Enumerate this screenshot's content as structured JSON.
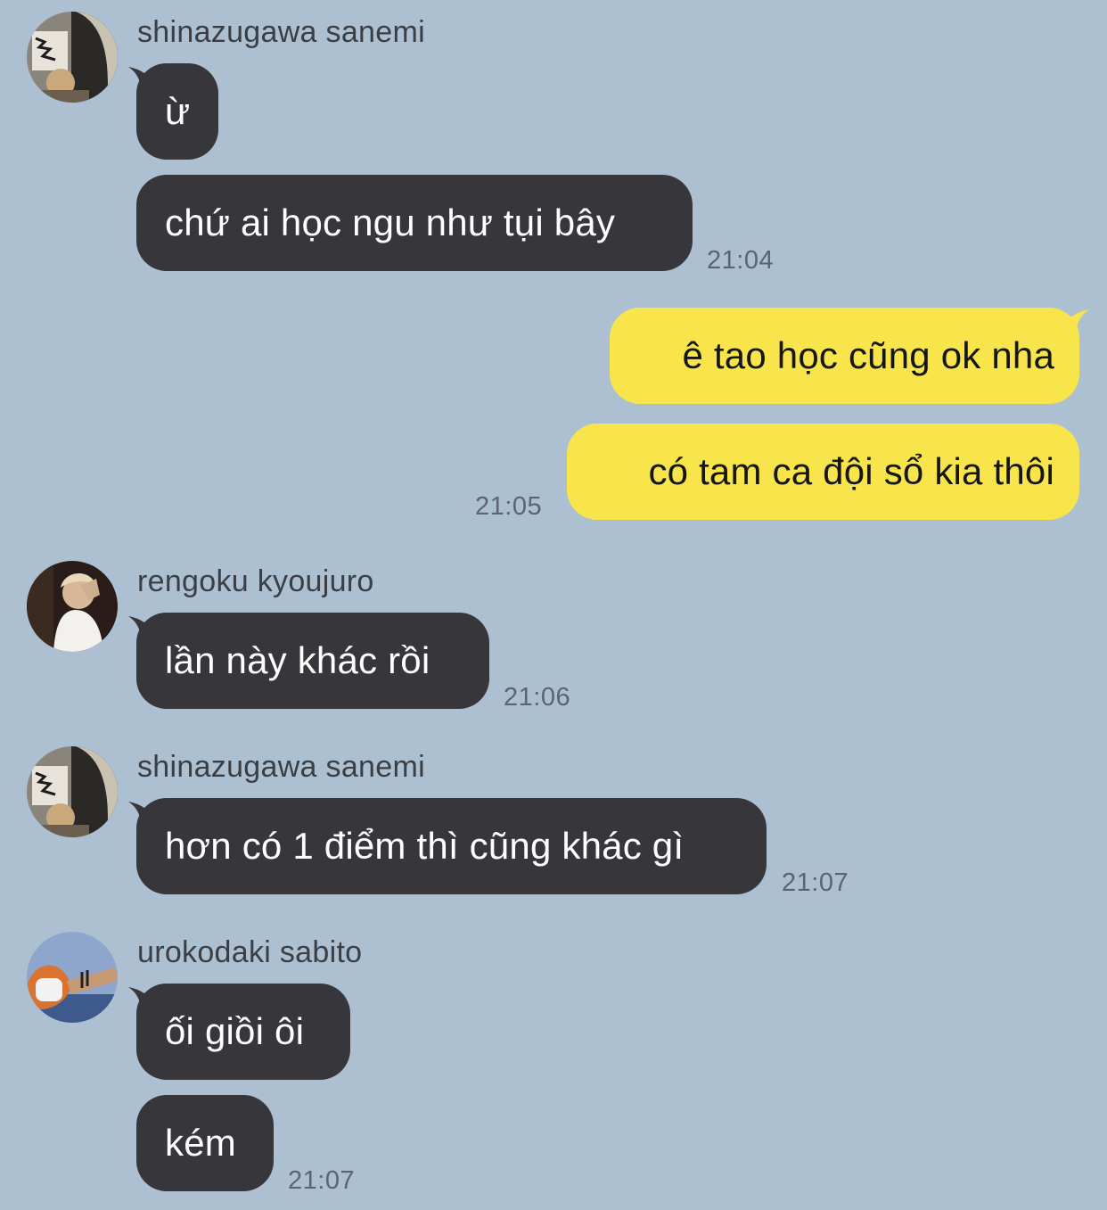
{
  "colors": {
    "background": "#adc0d1",
    "incoming_bubble": "#37373b",
    "outgoing_bubble": "#f8e54b"
  },
  "messages": [
    {
      "sender": "shinazugawa sanemi",
      "lines": [
        "ừ",
        "chứ ai học ngu như tụi bây"
      ],
      "time": "21:04"
    },
    {
      "sender": "me",
      "lines": [
        "ê tao học cũng ok nha",
        "có tam ca đội sổ kia thôi"
      ],
      "time": "21:05"
    },
    {
      "sender": "rengoku kyoujuro",
      "lines": [
        "lần này khác rồi"
      ],
      "time": "21:06"
    },
    {
      "sender": "shinazugawa sanemi",
      "lines": [
        "hơn có 1 điểm thì cũng khác gì"
      ],
      "time": "21:07"
    },
    {
      "sender": "urokodaki sabito",
      "lines": [
        "ối giồi ôi",
        "kém"
      ],
      "time": "21:07"
    }
  ]
}
